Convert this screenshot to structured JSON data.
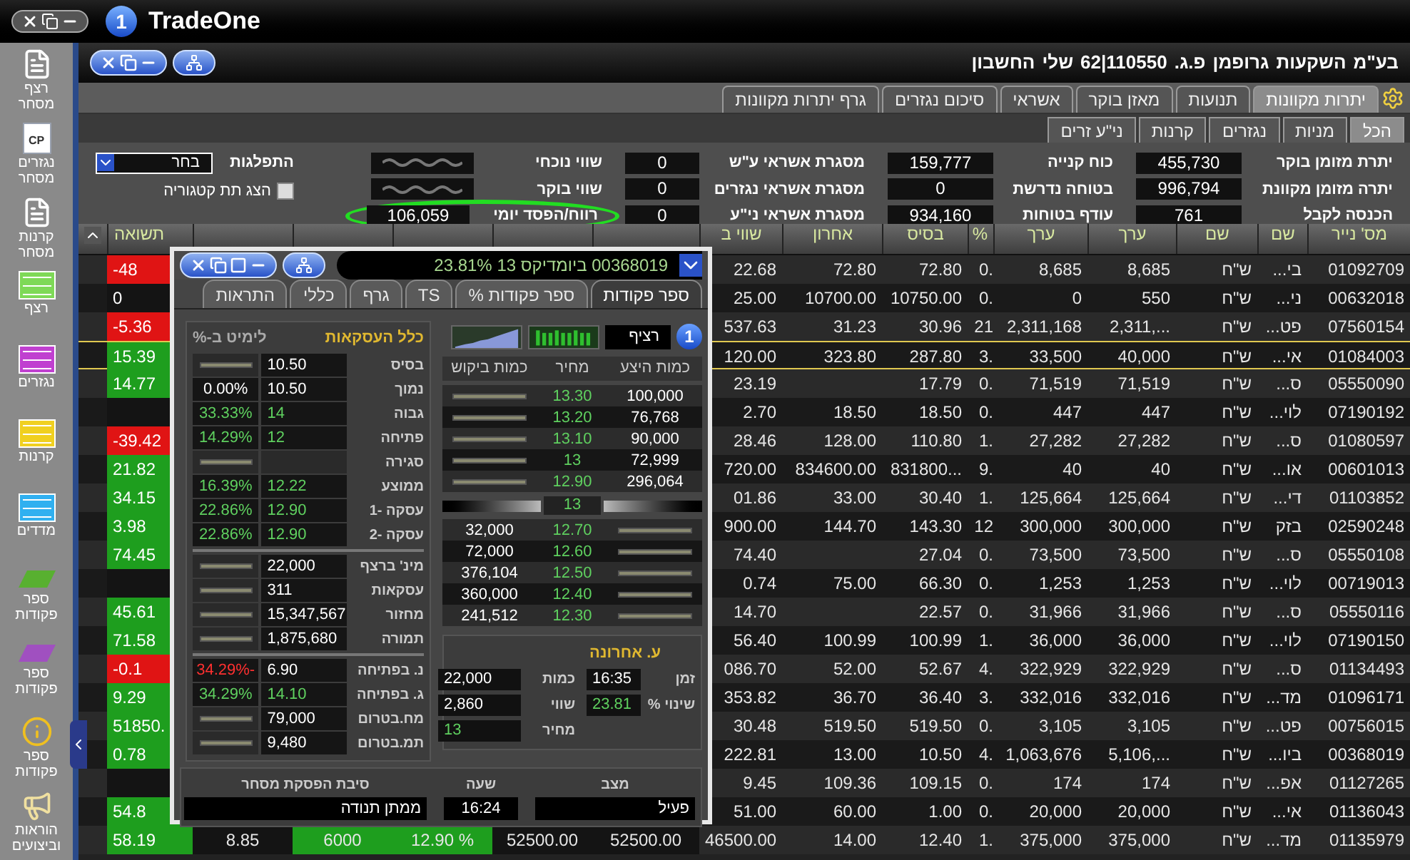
{
  "app": {
    "logo_mark": "1",
    "logo_text": "TradeOne"
  },
  "sidebar": {
    "items": [
      {
        "label": "רצף מסחר",
        "kind": "document"
      },
      {
        "label": "נגזרים מסחר",
        "kind": "document",
        "badge": "CP"
      },
      {
        "label": "קרנות מסחר",
        "kind": "document"
      },
      {
        "label": "רצף",
        "kind": "sheet",
        "color": "#7ed957"
      },
      {
        "label": "נגזרים",
        "kind": "sheet",
        "color": "#c040d0"
      },
      {
        "label": "קרנות",
        "kind": "sheet",
        "color": "#f0d020"
      },
      {
        "label": "מדדים",
        "kind": "sheet",
        "color": "#30b0f0"
      },
      {
        "label": "ספר פקודות",
        "kind": "book",
        "color": "#58b030"
      },
      {
        "label": "ספר פקודות",
        "kind": "book",
        "color": "#a050c0"
      },
      {
        "label": "ספר פקודות",
        "kind": "info"
      },
      {
        "label": "הוראות וביצועים",
        "kind": "megaphone"
      }
    ]
  },
  "account": {
    "words": [
      "בע\"מ",
      "השקעות",
      "גרופמן",
      "פ.ג.",
      "110550|62",
      "שלי",
      "החשבון"
    ]
  },
  "main_tabs": [
    {
      "label": "יתרות מקוונות",
      "selected": true
    },
    {
      "label": "תנועות",
      "selected": false
    },
    {
      "label": "מאזן בוקר",
      "selected": false
    },
    {
      "label": "אשראי",
      "selected": false
    },
    {
      "label": "סיכום נגזרים",
      "selected": false
    },
    {
      "label": "גרף יתרות מקוונות",
      "selected": false
    }
  ],
  "sub_tabs": [
    {
      "label": "הכל",
      "selected": true
    },
    {
      "label": "מניות",
      "selected": false
    },
    {
      "label": "נגזרים",
      "selected": false
    },
    {
      "label": "קרנות",
      "selected": false
    },
    {
      "label": "ני\"ע זרים",
      "selected": false
    }
  ],
  "summary": {
    "columns": [
      [
        {
          "label": "יתרת מזומן בוקר",
          "value": "455,730",
          "obscured": false,
          "circled": false
        },
        {
          "label": "יתרה מזומן מקוונת",
          "value": "996,794",
          "obscured": false,
          "circled": false
        },
        {
          "label": "הכנסה לקבל",
          "value": "761",
          "obscured": false,
          "circled": false
        }
      ],
      [
        {
          "label": "כוח קנייה",
          "value": "159,777",
          "obscured": false,
          "circled": false
        },
        {
          "label": "בטוחה נדרשת",
          "value": "0",
          "obscured": false,
          "circled": false
        },
        {
          "label": "עודף בטוחות",
          "value": "934,160",
          "obscured": false,
          "circled": false
        }
      ],
      [
        {
          "label": "מסגרת אשראי ע\"ש",
          "value": "0",
          "obscured": false,
          "circled": false
        },
        {
          "label": "מסגרת אשראי נגזרים",
          "value": "0",
          "obscured": false,
          "circled": false
        },
        {
          "label": "מסגרת אשראי ני\"ע",
          "value": "0",
          "obscured": false,
          "circled": false
        }
      ],
      [
        {
          "label": "שווי נוכחי",
          "obscured": true,
          "circled": false
        },
        {
          "label": "שווי בוקר",
          "obscured": true,
          "circled": false
        },
        {
          "label": "רווח/הפסד יומי",
          "value": "106,059",
          "obscured": false,
          "circled": true
        }
      ]
    ],
    "distribution": {
      "label": "התפלגות",
      "value": "בחר"
    },
    "subcategory": {
      "label": "הצג תת קטגוריה",
      "checked": false
    }
  },
  "table": {
    "columns": [
      "מס' נייר",
      "שם",
      "שם",
      "ערך",
      "ערך",
      "%",
      "בסיס",
      "אחרון",
      "שווי ב"
    ],
    "yield_column": "תשואה",
    "rows": [
      {
        "security_no": "01092709",
        "name": "בי...",
        "currency": "ש\"ח",
        "value_1": "8,685",
        "value_2": "8,685",
        "pct": "0.",
        "base": "72.80",
        "last": "72.80",
        "worth": "22.68",
        "yield": "-48",
        "color": "#e01414",
        "selected": false
      },
      {
        "security_no": "00632018",
        "name": "ני...",
        "currency": "ש\"ח",
        "value_1": "550",
        "value_2": "0",
        "pct": "0.",
        "base": "10750.00",
        "last": "10700.00",
        "worth": "25.00",
        "yield": "0",
        "color": "#141414",
        "selected": false
      },
      {
        "security_no": "07560154",
        "name": "פט...",
        "currency": "ש\"ח",
        "value_1": "2,311,...",
        "value_2": "2,311,168",
        "pct": "21",
        "base": "30.96",
        "last": "31.23",
        "worth": "537.63",
        "yield": "-5.36",
        "color": "#e01414",
        "selected": false
      },
      {
        "security_no": "01084003",
        "name": "אי...",
        "currency": "ש\"ח",
        "value_1": "40,000",
        "value_2": "33,500",
        "pct": "3.",
        "base": "287.80",
        "last": "323.80",
        "worth": "120.00",
        "yield": "15.39",
        "color": "#1e9e1e",
        "selected": true
      },
      {
        "security_no": "05550090",
        "name": "ס...",
        "currency": "ש\"ח",
        "value_1": "71,519",
        "value_2": "71,519",
        "pct": "0.",
        "base": "17.79",
        "worth": "23.19",
        "yield": "14.77",
        "color": "#1e9e1e",
        "selected": false
      },
      {
        "security_no": "07190192",
        "name": "לוי...",
        "currency": "ש\"ח",
        "value_1": "447",
        "value_2": "447",
        "pct": "0.",
        "base": "18.50",
        "last": "18.50",
        "worth": "2.70",
        "color": "#141414",
        "selected": false
      },
      {
        "security_no": "01080597",
        "name": "ס...",
        "currency": "ש\"ח",
        "value_1": "27,282",
        "value_2": "27,282",
        "pct": "1.",
        "base": "110.80",
        "last": "128.00",
        "worth": "28.46",
        "yield": "-39.42",
        "color": "#e01414",
        "selected": false
      },
      {
        "security_no": "00601013",
        "name": "או...",
        "currency": "ש\"ח",
        "value_1": "40",
        "value_2": "40",
        "pct": "9.",
        "base": "831800...",
        "last": "834600.00",
        "worth": "720.00",
        "yield": "21.82",
        "color": "#1e9e1e",
        "selected": false
      },
      {
        "security_no": "01103852",
        "name": "די...",
        "currency": "ש\"ח",
        "value_1": "125,664",
        "value_2": "125,664",
        "pct": "1.",
        "base": "30.40",
        "last": "33.00",
        "worth": "01.86",
        "yield": "34.15",
        "color": "#1e9e1e",
        "selected": false
      },
      {
        "security_no": "02590248",
        "name": "בזק",
        "currency": "ש\"ח",
        "value_1": "300,000",
        "value_2": "300,000",
        "pct": "12",
        "base": "143.30",
        "last": "144.70",
        "worth": "900.00",
        "yield": "3.98",
        "color": "#1e9e1e",
        "selected": false
      },
      {
        "security_no": "05550108",
        "name": "ס...",
        "currency": "ש\"ח",
        "value_1": "73,500",
        "value_2": "73,500",
        "pct": "0.",
        "base": "27.04",
        "worth": "74.40",
        "yield": "74.45",
        "color": "#1e9e1e",
        "selected": false
      },
      {
        "security_no": "00719013",
        "name": "לוי...",
        "currency": "ש\"ח",
        "value_1": "1,253",
        "value_2": "1,253",
        "pct": "0.",
        "base": "66.30",
        "last": "75.00",
        "worth": "0.74",
        "color": "#141414",
        "selected": false
      },
      {
        "security_no": "05550116",
        "name": "ס...",
        "currency": "ש\"ח",
        "value_1": "31,966",
        "value_2": "31,966",
        "pct": "0.",
        "base": "22.57",
        "worth": "14.70",
        "yield": "45.61",
        "color": "#1e9e1e",
        "selected": false
      },
      {
        "security_no": "07190150",
        "name": "לוי...",
        "currency": "ש\"ח",
        "value_1": "36,000",
        "value_2": "36,000",
        "pct": "1.",
        "base": "100.99",
        "last": "100.99",
        "worth": "56.40",
        "yield": "71.58",
        "color": "#1e9e1e",
        "selected": false
      },
      {
        "security_no": "01134493",
        "name": "ס...",
        "currency": "ש\"ח",
        "value_1": "322,929",
        "value_2": "322,929",
        "pct": "4.",
        "base": "52.67",
        "last": "52.00",
        "worth": "086.70",
        "yield": "-0.1",
        "color": "#e01414",
        "selected": false
      },
      {
        "security_no": "01096171",
        "name": "מד...",
        "currency": "ש\"ח",
        "value_1": "332,016",
        "value_2": "332,016",
        "pct": "3.",
        "base": "36.40",
        "last": "36.70",
        "worth": "353.82",
        "yield": "9.29",
        "color": "#1e9e1e",
        "selected": false
      },
      {
        "security_no": "00756015",
        "name": "פט...",
        "currency": "ש\"ח",
        "value_1": "3,105",
        "value_2": "3,105",
        "pct": "0.",
        "base": "519.50",
        "last": "519.50",
        "worth": "30.48",
        "yield": "51850.",
        "color": "#1e9e1e",
        "selected": false
      },
      {
        "security_no": "00368019",
        "name": "ביו...",
        "currency": "ש\"ח",
        "value_1": "5,106,...",
        "value_2": "1,063,676",
        "pct": "4.",
        "base": "10.50",
        "last": "13.00",
        "worth": "222.81",
        "yield": "0.78",
        "color": "#1e9e1e",
        "selected": false
      },
      {
        "security_no": "01127265",
        "name": "אפ...",
        "currency": "ש\"ח",
        "value_1": "174",
        "value_2": "174",
        "pct": "0.",
        "base": "109.15",
        "last": "109.36",
        "worth": "9.45",
        "color": "#141414",
        "selected": false
      },
      {
        "security_no": "01136043",
        "name": "אי...",
        "currency": "ש\"ח",
        "value_1": "20,000",
        "value_2": "20,000",
        "pct": "0.",
        "base": "1.00",
        "last": "60.00",
        "worth": "51.00",
        "yield": "54.8",
        "color": "#1e9e1e",
        "selected": false
      },
      {
        "security_no": "01135979",
        "name": "מד...",
        "currency": "ש\"ח",
        "value_1": "375,000",
        "value_2": "375,000",
        "pct": "1.",
        "base": "12.40",
        "last": "14.00",
        "worth": "46500.00",
        "yield": "58.19",
        "color": "#1e9e1e",
        "selected": false,
        "middle_cells": [
          {
            "text": "52500.00",
            "color": "#141414"
          },
          {
            "text": "52500.00",
            "color": "#141414"
          },
          {
            "text": "12.90 %",
            "color": "#1e9e1e"
          },
          {
            "text": "6000",
            "color": "#1e9e1e"
          },
          {
            "text": "8.85",
            "color": "#141414"
          }
        ]
      }
    ]
  },
  "order_window": {
    "title": "00368019 ביומדיקס 13 23.81%",
    "tabs": [
      {
        "label": "ספר פקודות",
        "selected": true
      },
      {
        "label": "ספר פקודות %",
        "selected": false
      },
      {
        "label": "TS",
        "selected": false
      },
      {
        "label": "גרף",
        "selected": false
      },
      {
        "label": "כללי",
        "selected": false
      },
      {
        "label": "התראות",
        "selected": false
      }
    ],
    "info_mark": "1",
    "mode": "רציף",
    "book": {
      "columns": [
        "כמות היצע",
        "מחיר",
        "כמות ביקוש"
      ],
      "asks": [
        {
          "qty": "100,000",
          "price": "13.30"
        },
        {
          "qty": "76,768",
          "price": "13.20"
        },
        {
          "qty": "90,000",
          "price": "13.10"
        },
        {
          "qty": "72,999",
          "price": "13"
        },
        {
          "qty": "296,064",
          "price": "12.90"
        }
      ],
      "last_price": "13",
      "bids": [
        {
          "qty": "32,000",
          "price": "12.70"
        },
        {
          "qty": "72,000",
          "price": "12.60"
        },
        {
          "qty": "376,104",
          "price": "12.50"
        },
        {
          "qty": "360,000",
          "price": "12.40"
        },
        {
          "qty": "241,512",
          "price": "12.30"
        }
      ]
    },
    "last_trade": {
      "title": "ע. אחרונה",
      "right": [
        {
          "label": "זמן",
          "value": "16:35",
          "positive": false
        },
        {
          "label": "שינוי %",
          "value": "23.81",
          "positive": true
        }
      ],
      "left": [
        {
          "label": "כמות",
          "value": "22,000",
          "positive": false
        },
        {
          "label": "שווי",
          "value": "2,860",
          "positive": false
        },
        {
          "label": "מחיר",
          "value": "13",
          "positive": true
        }
      ]
    },
    "stats": {
      "title": "כלל העסקאות",
      "limit_title": "לימיט ב-%",
      "groups": [
        [
          {
            "label": "בסיס",
            "value": "10.50"
          },
          {
            "label": "נמוך",
            "value": "10.50",
            "pct": "0.00%",
            "positive": false,
            "negative": false
          },
          {
            "label": "גבוה",
            "value": "14",
            "pct": "33.33%",
            "positive": true,
            "negative": false
          },
          {
            "label": "פתיחה",
            "value": "12",
            "pct": "14.29%",
            "positive": true,
            "negative": false
          },
          {
            "label": "סגירה"
          },
          {
            "label": "ממוצע",
            "value": "12.22",
            "pct": "16.39%",
            "positive": true,
            "negative": false
          },
          {
            "label": "עסקה -1",
            "value": "12.90",
            "pct": "22.86%",
            "positive": true,
            "negative": false
          },
          {
            "label": "עסקה -2",
            "value": "12.90",
            "pct": "22.86%",
            "positive": true,
            "negative": false
          }
        ],
        [
          {
            "label": "מינ' ברצף",
            "value": "22,000"
          },
          {
            "label": "עסקאות",
            "value": "311"
          },
          {
            "label": "מחזור",
            "value": "15,347,567"
          },
          {
            "label": "תמורה",
            "value": "1,875,680"
          }
        ],
        [
          {
            "label": "נ. בפתיחה",
            "value": "6.90",
            "pct": "-34.29%",
            "positive": false,
            "negative": true
          },
          {
            "label": "ג. בפתיחה",
            "value": "14.10",
            "pct": "34.29%",
            "positive": true,
            "negative": false
          },
          {
            "label": "מח.בטרום",
            "value": "79,000"
          },
          {
            "label": "תמ.בטרום",
            "value": "9,480"
          }
        ]
      ]
    },
    "status": [
      {
        "label": "מצב",
        "value": "פעיל"
      },
      {
        "label": "שעה",
        "value": "16:24"
      },
      {
        "label": "סיבת הפסקת מסחר",
        "value": "ממתן תנודה"
      }
    ]
  }
}
